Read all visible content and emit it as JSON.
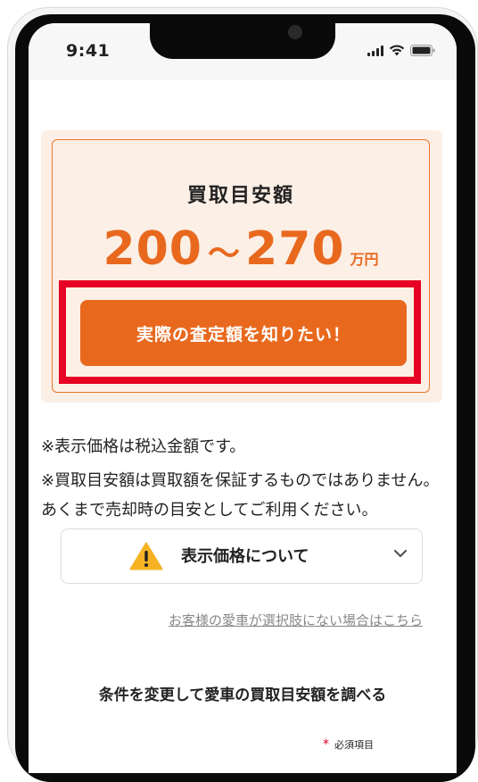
{
  "status_bar": {
    "time": "9:41"
  },
  "estimate": {
    "title": "買取目安額",
    "min": "200",
    "separator": "〜",
    "max": "270",
    "unit": "万円",
    "cta_label": "実際の査定額を知りたい！"
  },
  "notes": {
    "tax": "※表示価格は税込金額です。",
    "disclaimer": "※買取目安額は買取額を保証するものではありません。あくまで売却時の目安としてご利用ください。"
  },
  "info_panel": {
    "label": "表示価格について"
  },
  "links": {
    "not_listed": "お客様の愛車が選択肢にない場合はこちら"
  },
  "section": {
    "heading": "条件を変更して愛車の買取目安額を調べる"
  },
  "required": {
    "marker": "*",
    "label": "必須項目"
  },
  "colors": {
    "accent": "#e8691e",
    "highlight": "#e60023",
    "card_bg": "#fcefe6"
  }
}
